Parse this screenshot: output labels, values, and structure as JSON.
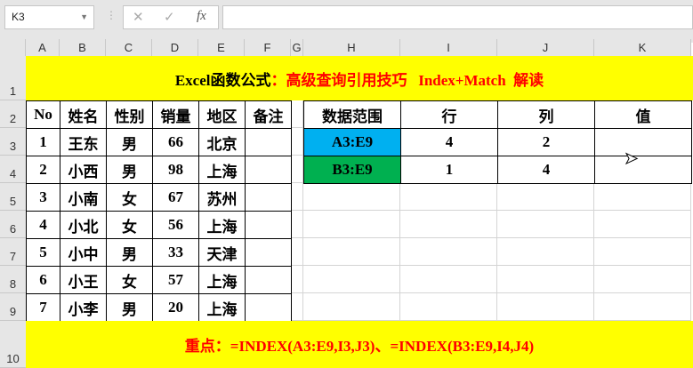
{
  "formula_bar": {
    "name_box": "K3",
    "cancel": "✕",
    "enter": "✓",
    "fx": "fx",
    "formula": ""
  },
  "columns": [
    "A",
    "B",
    "C",
    "D",
    "E",
    "F",
    "G",
    "H",
    "I",
    "J",
    "K"
  ],
  "rows": [
    "1",
    "2",
    "3",
    "4",
    "5",
    "6",
    "7",
    "8",
    "9",
    "10"
  ],
  "title": {
    "black": "Excel函数公式",
    "colon": "：",
    "red": "高级查询引用技巧   Index+Match  解读"
  },
  "table1": {
    "headers": [
      "No",
      "姓名",
      "性别",
      "销量",
      "地区",
      "备注"
    ],
    "rows": [
      [
        "1",
        "王东",
        "男",
        "66",
        "北京",
        ""
      ],
      [
        "2",
        "小西",
        "男",
        "98",
        "上海",
        ""
      ],
      [
        "3",
        "小南",
        "女",
        "67",
        "苏州",
        ""
      ],
      [
        "4",
        "小北",
        "女",
        "56",
        "上海",
        ""
      ],
      [
        "5",
        "小中",
        "男",
        "33",
        "天津",
        ""
      ],
      [
        "6",
        "小王",
        "女",
        "57",
        "上海",
        ""
      ],
      [
        "7",
        "小李",
        "男",
        "20",
        "上海",
        ""
      ]
    ]
  },
  "table2": {
    "headers": [
      "数据范围",
      "行",
      "列",
      "值"
    ],
    "rows": [
      [
        "A3:E9",
        "4",
        "2",
        ""
      ],
      [
        "B3:E9",
        "1",
        "4",
        ""
      ]
    ],
    "colors": [
      "#00b0f0",
      "#00b050"
    ]
  },
  "footer": {
    "label": "重点：",
    "formula": "=INDEX(A3:E9,I3,J3)、=INDEX(B3:E9,I4,J4)"
  }
}
